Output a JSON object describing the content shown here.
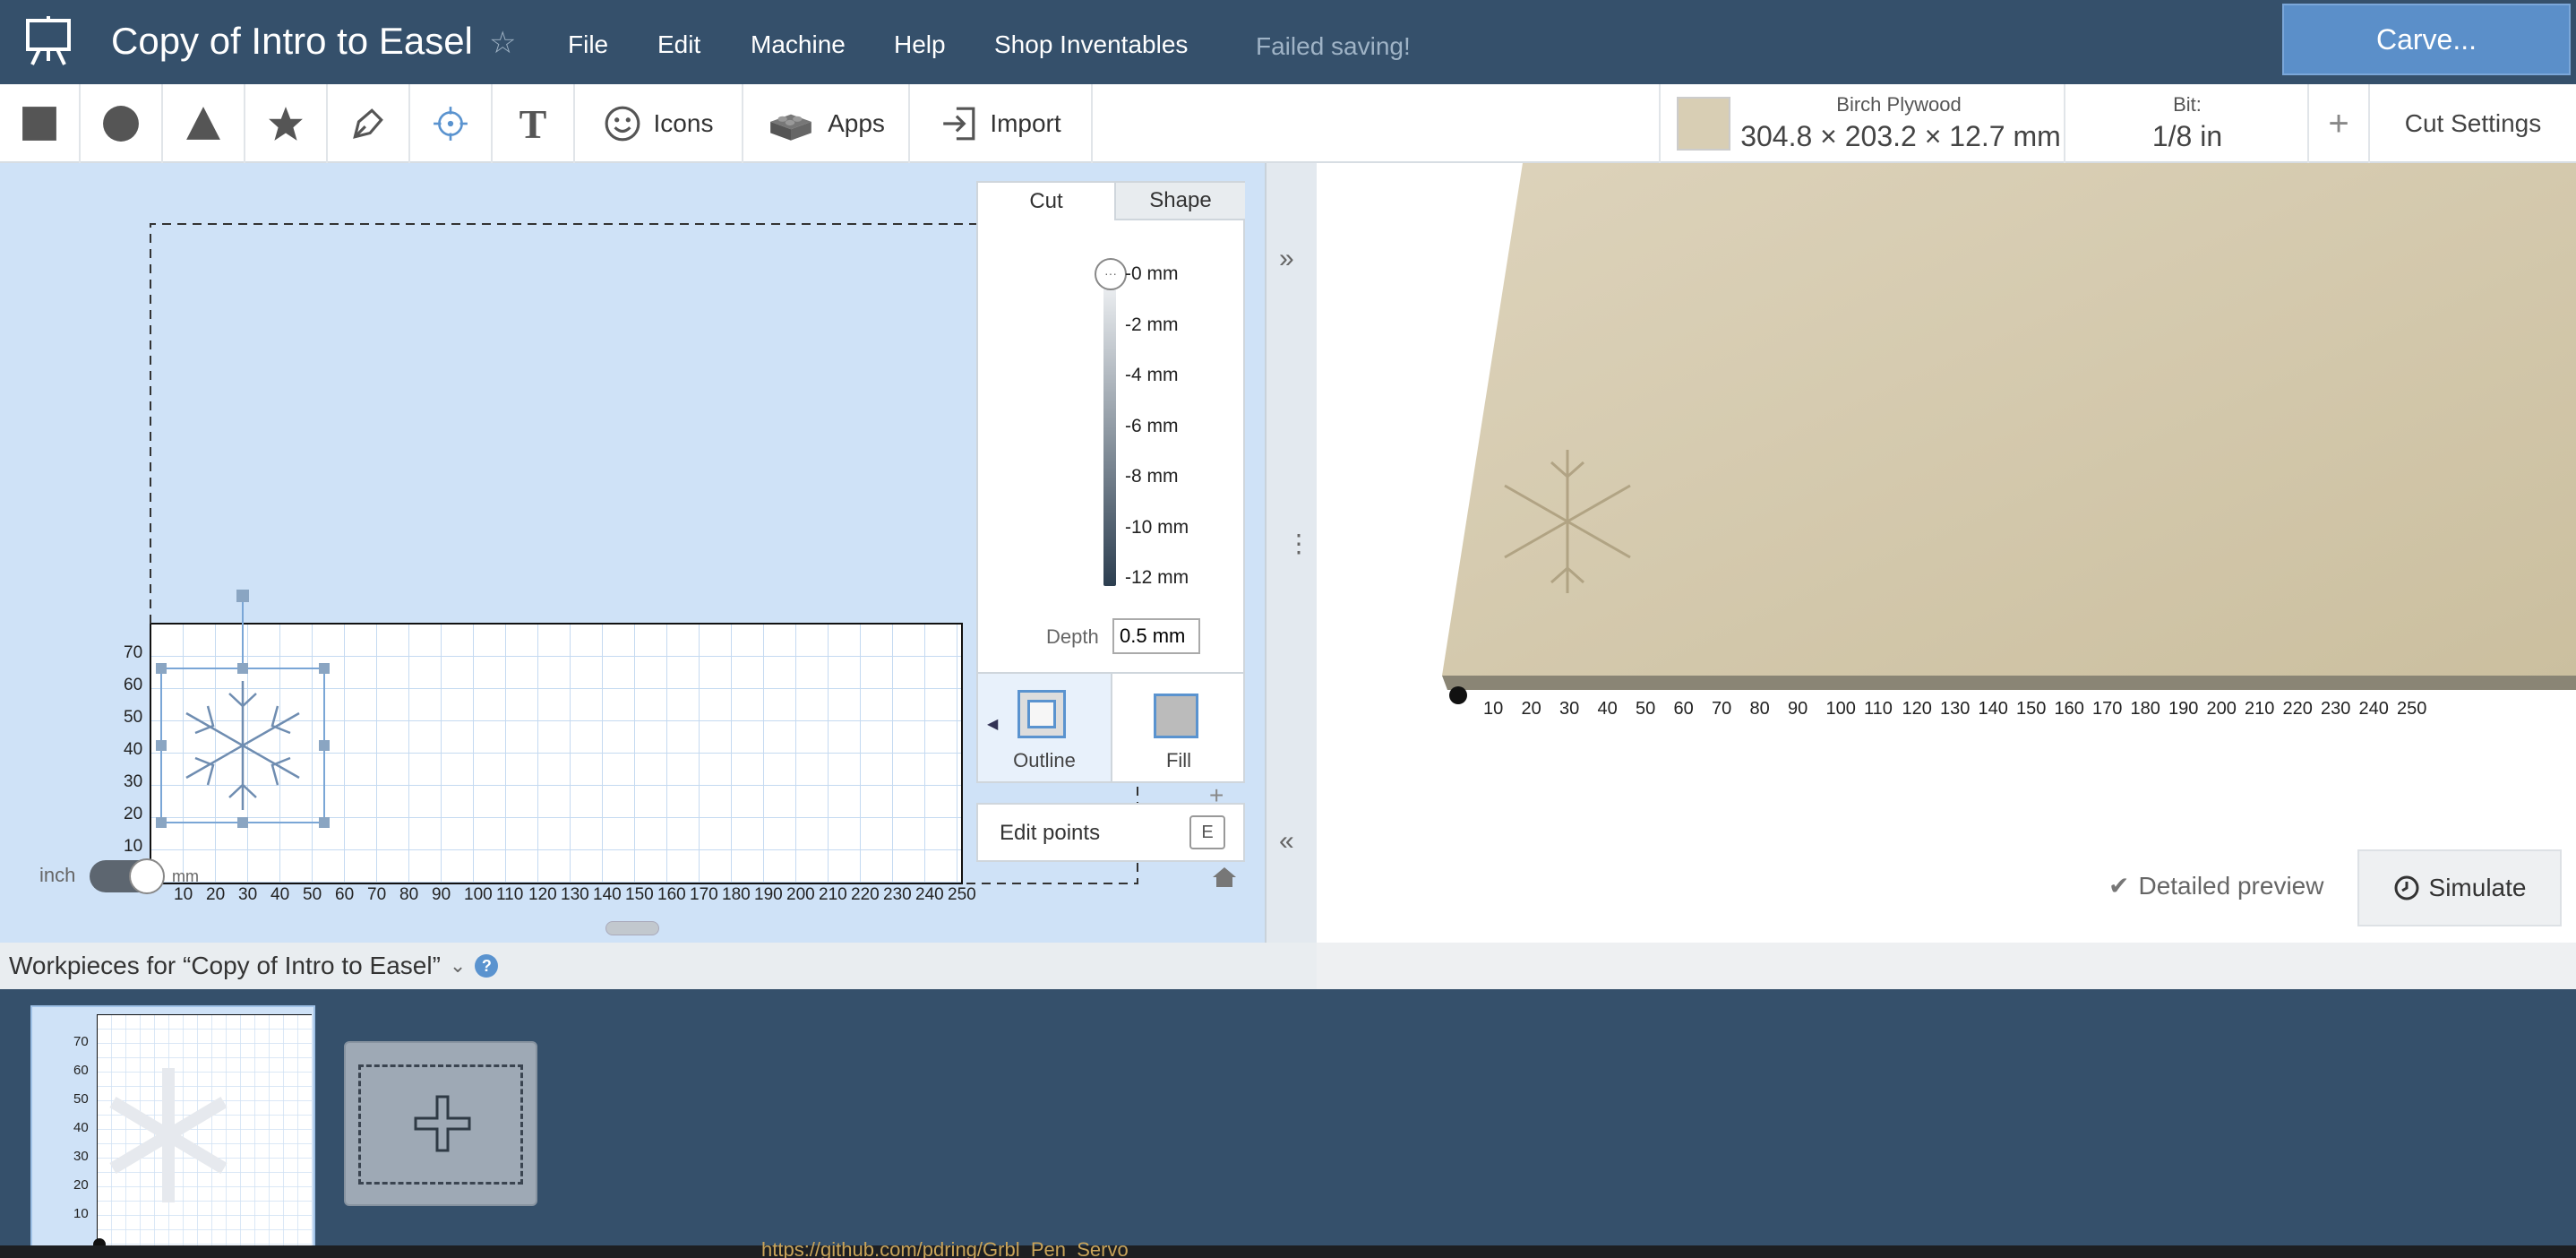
{
  "app": {
    "title": "Copy of Intro to Easel",
    "menus": [
      "File",
      "Edit",
      "Machine",
      "Help",
      "Shop Inventables"
    ],
    "status": "Failed saving!",
    "carve_label": "Carve..."
  },
  "toolbar": {
    "icons_label": "Icons",
    "apps_label": "Apps",
    "import_label": "Import"
  },
  "material": {
    "name": "Birch Plywood",
    "dims": "304.8 × 203.2 × 12.7 mm",
    "bit_label": "Bit:",
    "bit_value": "1/8 in",
    "add_label": "+",
    "cut_settings_label": "Cut Settings",
    "swatch_color": "#d8ceb4"
  },
  "cut_panel": {
    "tabs": [
      "Cut",
      "Shape"
    ],
    "depth_ticks": [
      "-0 mm",
      "-2 mm",
      "-4 mm",
      "-6 mm",
      "-8 mm",
      "-10 mm",
      "-12 mm"
    ],
    "depth_label": "Depth",
    "depth_value": "0.5 mm",
    "outline_label": "Outline",
    "fill_label": "Fill",
    "edit_points_label": "Edit points",
    "edit_points_key": "E"
  },
  "canvas": {
    "unit_left": "inch",
    "unit_right": "mm",
    "x_ticks": [
      "10",
      "20",
      "30",
      "40",
      "50",
      "60",
      "70",
      "80",
      "90",
      "100",
      "110",
      "120",
      "130",
      "140",
      "150",
      "160",
      "170",
      "180",
      "190",
      "200",
      "210",
      "220",
      "230",
      "240",
      "250"
    ],
    "y_ticks": [
      "70",
      "60",
      "50",
      "40",
      "30",
      "20",
      "10"
    ]
  },
  "preview": {
    "x_ticks": [
      "10",
      "20",
      "30",
      "40",
      "50",
      "60",
      "70",
      "80",
      "90",
      "100",
      "110",
      "120",
      "130",
      "140",
      "150",
      "160",
      "170",
      "180",
      "190",
      "200",
      "210",
      "220",
      "230",
      "240",
      "250"
    ],
    "detailed_label": "Detailed preview",
    "simulate_label": "Simulate"
  },
  "workpieces": {
    "title": "Workpieces for “Copy of Intro to Easel”",
    "thumb_y_ticks": [
      "70",
      "60",
      "50",
      "40",
      "30",
      "20",
      "10"
    ]
  },
  "taskbar": {
    "link_text": "https://github.com/pdring/Grbl_Pen_Servo"
  }
}
